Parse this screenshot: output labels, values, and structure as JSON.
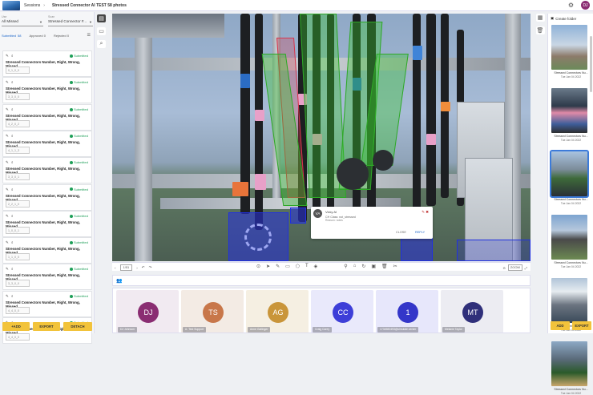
{
  "app": {
    "breadcrumb": [
      "Sessions",
      "Stressed Connector AI TEST 58 photos"
    ],
    "user_initials": "DJ"
  },
  "filters": {
    "left": {
      "label": "Use",
      "value": "All Missed"
    },
    "right": {
      "label": "Scan",
      "value": "Stressed Connector F..."
    }
  },
  "tabs": [
    {
      "label": "Submitted",
      "count": "58"
    },
    {
      "label": "Approved",
      "count": "0"
    },
    {
      "label": "Rejected",
      "count": "0"
    }
  ],
  "cards": [
    {
      "status": "Submitted",
      "title": "Stressed Connectors Number, Right, Wrong, Missed",
      "value": "0_1_0_0"
    },
    {
      "status": "Submitted",
      "title": "Stressed Connectors Number, Right, Wrong, Missed",
      "value": "3_3_0_0"
    },
    {
      "status": "Submitted",
      "title": "Stressed Connectors Number, Right, Wrong, Missed",
      "value": "4_2_0_2"
    },
    {
      "status": "Submitted",
      "title": "Stressed Connectors Number, Right, Wrong, Missed",
      "value": "4_1_1_3"
    },
    {
      "status": "Submitted",
      "title": "Stressed Connectors Number, Right, Wrong, Missed",
      "value": "3_3_0_1"
    },
    {
      "status": "Submitted",
      "title": "Stressed Connectors Number, Right, Wrong, Missed",
      "value": "2_2_1_0"
    },
    {
      "status": "Submitted",
      "title": "Stressed Connectors Number, Right, Wrong, Missed",
      "value": "1_0_0_1"
    },
    {
      "status": "Submitted",
      "title": "Stressed Connectors Number, Right, Wrong, Missed",
      "value": "1_1_0_0"
    },
    {
      "status": "Submitted",
      "title": "Stressed Connectors Number, Right, Wrong, Missed",
      "value": "3_3_0_0"
    },
    {
      "status": "Submitted",
      "title": "Stressed Connectors Number, Right, Wrong, Missed",
      "value": "4_4_0_0"
    },
    {
      "status": "Submitted",
      "title": "Stressed Connectors Number, Right, Wrong, Missed",
      "value": "4_4_0_0"
    }
  ],
  "left_buttons": [
    "+ADD",
    "EXPORT",
    "DETACH"
  ],
  "comment": {
    "initials": "VA",
    "author": "Vicky AI",
    "line1": "CH Class: not_stressed",
    "line2": "Reason: notes",
    "close": "CLOSE",
    "reply": "REPLY"
  },
  "controls": {
    "page": "1/51",
    "zoom": "ZOOM"
  },
  "people": [
    {
      "initials": "DJ",
      "name": "DJ Johnson",
      "bg": "#f1eaf1",
      "color": "#8a2d72"
    },
    {
      "initials": "TS",
      "name": "A. Test Support",
      "bg": "#f3ebe4",
      "color": "#c8774a"
    },
    {
      "initials": "AG",
      "name": "Anne Gallinger",
      "bg": "#f5efe2",
      "color": "#c9953a"
    },
    {
      "initials": "CC",
      "name": "Craig Carey",
      "bg": "#e9e9fb",
      "color": "#3d3ed8"
    },
    {
      "initials": "1",
      "name": "1734580493@simulate.center",
      "bg": "#e7e7fb",
      "color": "#3436c9"
    },
    {
      "initials": "MT",
      "name": "Melanie Taylor",
      "bg": "#ececf2",
      "color": "#2f2f7a"
    }
  ],
  "gallery": {
    "header": "Create folder",
    "items": [
      {
        "caption": "Stressed Connectors Nu...",
        "date": "Tue Jan 04 2022"
      },
      {
        "caption": "Stressed Connectors Nu...",
        "date": "Tue Jan 04 2022"
      },
      {
        "caption": "Stressed Connectors Nu...",
        "date": "Tue Jan 04 2022"
      },
      {
        "caption": "Stressed Connectors Nu...",
        "date": "Tue Jan 04 2022"
      },
      {
        "caption": "Stressed Connectors Nu...",
        "date": "Tue Jan 04 2022"
      },
      {
        "caption": "Stressed Connectors Nu...",
        "date": "Tue Jan 04 2022"
      }
    ],
    "buttons": [
      "ADD",
      "EXPORT"
    ]
  }
}
